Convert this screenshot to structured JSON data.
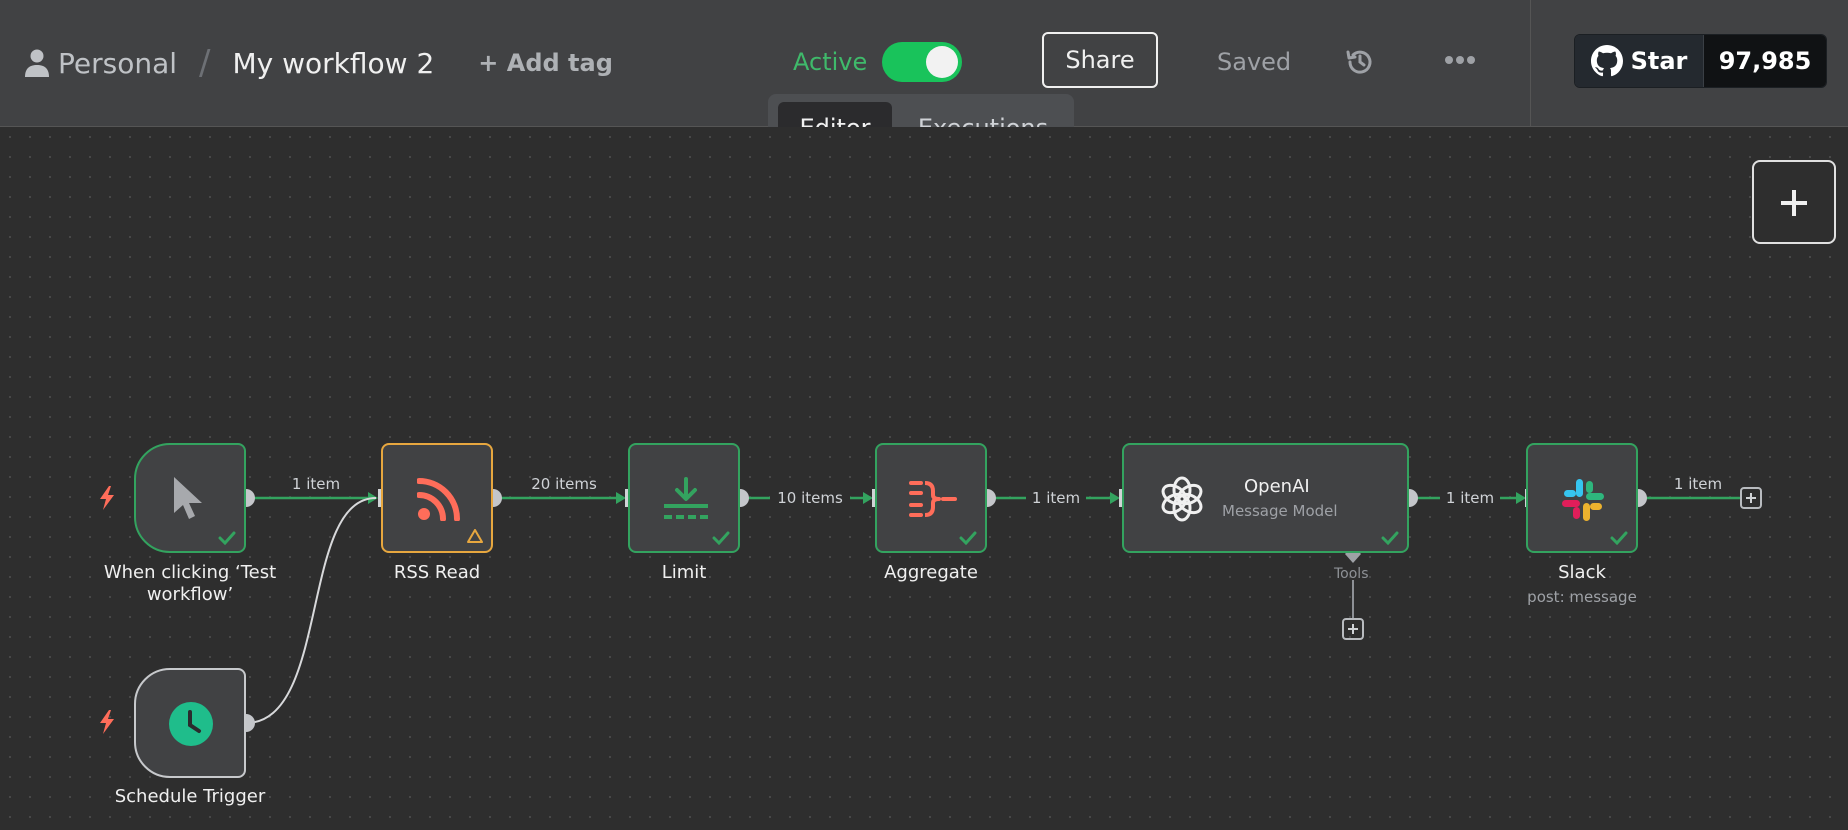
{
  "header": {
    "breadcrumb": {
      "project": "Personal",
      "separator": "/",
      "workflow": "My workflow 2"
    },
    "add_tag": "+ Add tag",
    "active_label": "Active",
    "share": "Share",
    "saved": "Saved",
    "github": {
      "star": "Star",
      "count": "97,985"
    }
  },
  "tabs": {
    "editor": "Editor",
    "executions": "Executions",
    "selected": "Editor"
  },
  "nodes": {
    "manual": {
      "label": "When clicking ‘Test workflow’"
    },
    "schedule": {
      "label": "Schedule Trigger"
    },
    "rss": {
      "label": "RSS Read"
    },
    "limit": {
      "label": "Limit"
    },
    "aggregate": {
      "label": "Aggregate"
    },
    "openai": {
      "title": "OpenAI",
      "subtitle": "Message Model",
      "tools": "Tools"
    },
    "slack": {
      "label": "Slack",
      "subtitle": "post: message"
    }
  },
  "edges": {
    "manual_rss": "1 item",
    "rss_limit": "20 items",
    "limit_aggregate": "10 items",
    "aggregate_openai": "1 item",
    "openai_slack": "1 item",
    "slack_out": "1 item"
  },
  "colors": {
    "success": "#33a35f",
    "warning": "#e7a73f",
    "trigger_bolt": "#ff6d5a",
    "active_toggle": "#19c35b"
  }
}
